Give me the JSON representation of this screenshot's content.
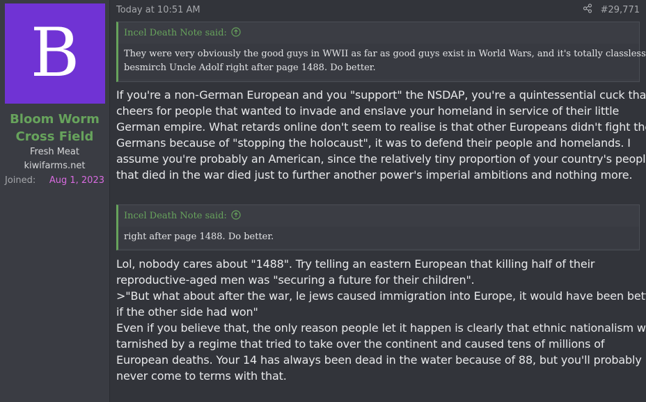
{
  "user": {
    "avatar_letter": "B",
    "name_line1": "Bloom Worm",
    "name_line2": "Cross Field",
    "title": "Fresh Meat",
    "site": "kiwifarms.net",
    "joined_label": "Joined:",
    "joined_date": "Aug 1, 2023",
    "avatar_color": "#7033d4",
    "name_color": "#67a35c"
  },
  "post": {
    "timestamp": "Today at 10:51 AM",
    "share_icon": "share-icon",
    "number": "#29,771",
    "quote1": {
      "author": "Incel Death Note said:",
      "icon": "arrow-up-circle-icon",
      "lines": [
        "They were very obviously the good guys in WWII as far as good guys exist in World Wars, and it's totally classless to",
        "besmirch Uncle Adolf right after page 1488. Do better."
      ]
    },
    "paragraph1": [
      "If you're a non-German European and you \"support\" the NSDAP, you're a quintessential cuck that",
      "cheers for people that wanted to invade and enslave your homeland in service of their little",
      "German empire. What retards online don't seem to realise is that other Europeans didn't fight the",
      "Germans because of \"stopping the holocaust\", it was to defend their people and homelands. I",
      "assume you're probably an American, since the relatively tiny proportion of your country's people",
      "that died in the war died just to further another power's imperial ambitions and nothing more."
    ],
    "quote2": {
      "author": "Incel Death Note said:",
      "icon": "arrow-up-circle-icon",
      "lines": [
        "right after page 1488. Do better."
      ]
    },
    "paragraph2": [
      "Lol, nobody cares about \"1488\". Try telling an eastern European that killing half of their",
      "reproductive-aged men was \"securing a future for their children\".",
      ">\"But what about after the war, le jews caused immigration into Europe, it would have been better",
      "if the other side had won\"",
      "Even if you believe that, the only reason people let it happen is clearly that ethnic nationalism was",
      "tarnished by a regime that tried to take over the continent and caused tens of millions of",
      "European deaths. Your 14 has always been dead in the water because of 88, but you'll probably",
      "never come to terms with that."
    ]
  }
}
